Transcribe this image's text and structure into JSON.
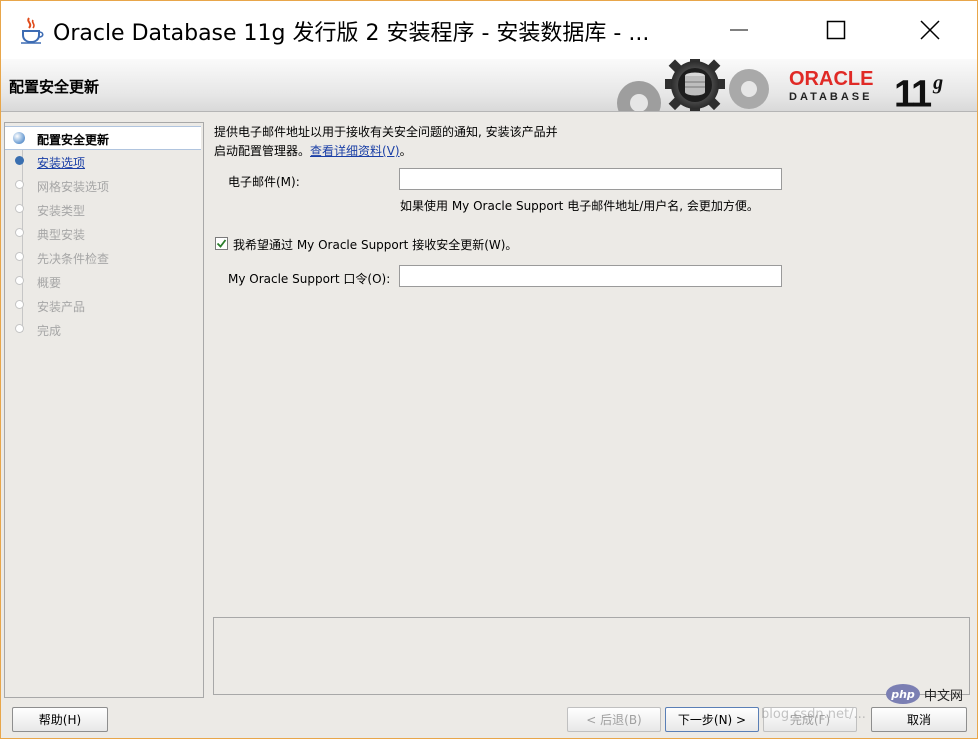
{
  "window": {
    "title": "Oracle Database 11g 发行版 2 安装程序 - 安装数据库 - ..."
  },
  "banner": {
    "title": "配置安全更新",
    "brand": "ORACLE",
    "product": "DATABASE",
    "version": "11",
    "version_sup": "g"
  },
  "nav": {
    "items": [
      {
        "label": "配置安全更新",
        "state": "active"
      },
      {
        "label": "安装选项",
        "state": "link"
      },
      {
        "label": "网格安装选项",
        "state": "disabled"
      },
      {
        "label": "安装类型",
        "state": "disabled"
      },
      {
        "label": "典型安装",
        "state": "disabled"
      },
      {
        "label": "先决条件检查",
        "state": "disabled"
      },
      {
        "label": "概要",
        "state": "disabled"
      },
      {
        "label": "安装产品",
        "state": "disabled"
      },
      {
        "label": "完成",
        "state": "disabled"
      }
    ]
  },
  "main": {
    "intro_line1": "提供电子邮件地址以用于接收有关安全问题的通知, 安装该产品并",
    "intro_line2": "启动配置管理器。",
    "details_link": "查看详细资料(V)",
    "intro_end": "。",
    "email_label": "电子邮件(M):",
    "email_value": "",
    "email_hint": "如果使用 My Oracle Support 电子邮件地址/用户名, 会更加方便。",
    "receive_updates_label": "我希望通过 My Oracle Support 接收安全更新(W)。",
    "receive_updates_checked": true,
    "password_label": "My Oracle Support 口令(O):",
    "password_value": ""
  },
  "buttons": {
    "help": "帮助(H)",
    "back": "< 后退(B)",
    "next": "下一步(N) >",
    "finish": "完成(F)",
    "cancel": "取消"
  },
  "overlay": {
    "watermark": "blog.csdn.net/...",
    "php_badge": "php",
    "php_site": "中文网"
  },
  "colors": {
    "oracle_red": "#e02a26",
    "link_blue": "#1a3fa6",
    "window_border": "#e8a64a"
  }
}
